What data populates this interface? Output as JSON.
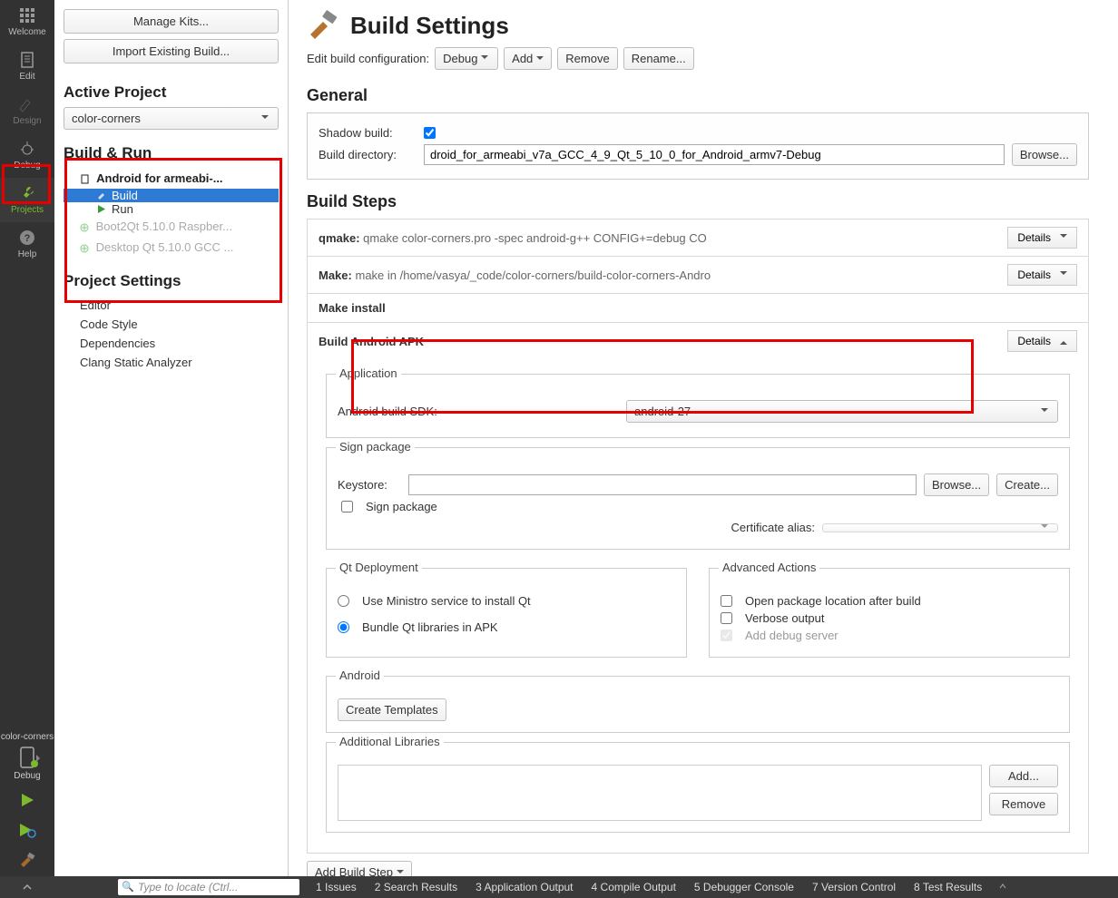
{
  "modebar": {
    "welcome": "Welcome",
    "edit": "Edit",
    "design": "Design",
    "debug": "Debug",
    "projects": "Projects",
    "help": "Help",
    "kit_name": "color-corners",
    "debug_label": "Debug"
  },
  "kits": {
    "manage": "Manage Kits...",
    "import": "Import Existing Build..."
  },
  "active_project": {
    "title": "Active Project",
    "value": "color-corners"
  },
  "build_run": {
    "title": "Build & Run",
    "kit": "Android for armeabi-...",
    "build": "Build",
    "run": "Run",
    "ghost1": "Boot2Qt 5.10.0 Raspber...",
    "ghost2": "Desktop Qt 5.10.0 GCC ..."
  },
  "project_settings": {
    "title": "Project Settings",
    "items": [
      "Editor",
      "Code Style",
      "Dependencies",
      "Clang Static Analyzer"
    ]
  },
  "main": {
    "title": "Build Settings",
    "edit_config": "Edit build configuration:",
    "config_value": "Debug",
    "add": "Add",
    "remove": "Remove",
    "rename": "Rename...",
    "general": "General",
    "shadow_build": "Shadow build:",
    "build_dir_label": "Build directory:",
    "build_dir_value": "droid_for_armeabi_v7a_GCC_4_9_Qt_5_10_0_for_Android_armv7-Debug",
    "browse": "Browse...",
    "build_steps": "Build Steps",
    "step1_label": "qmake:",
    "step1_desc": "qmake color-corners.pro -spec android-g++ CONFIG+=debug CO",
    "step2_label": "Make:",
    "step2_desc": "make in /home/vasya/_code/color-corners/build-color-corners-Andro",
    "step3_label": "Make install",
    "step4_label": "Build Android APK",
    "details": "Details",
    "apk": {
      "application": "Application",
      "sdk_label": "Android build SDK:",
      "sdk_value": "android-27",
      "sign_pkg": "Sign package",
      "keystore": "Keystore:",
      "browse": "Browse...",
      "create": "Create...",
      "sign_pkg_chk": "Sign package",
      "cert_alias": "Certificate alias:",
      "qt_deploy": "Qt Deployment",
      "ministro": "Use Ministro service to install Qt",
      "bundle": "Bundle Qt libraries in APK",
      "adv_actions": "Advanced Actions",
      "open_pkg": "Open package location after build",
      "verbose": "Verbose output",
      "debug_srv": "Add debug server",
      "android": "Android",
      "create_tmpl": "Create Templates",
      "add_libs": "Additional Libraries",
      "add_btn": "Add...",
      "remove_btn": "Remove"
    },
    "add_build_step": "Add Build Step"
  },
  "statusbar": {
    "locator_placeholder": "Type to locate (Ctrl...",
    "i1": "1 Issues",
    "i2": "2 Search Results",
    "i3": "3 Application Output",
    "i4": "4 Compile Output",
    "i5": "5 Debugger Console",
    "i7": "7 Version Control",
    "i8": "8 Test Results"
  }
}
